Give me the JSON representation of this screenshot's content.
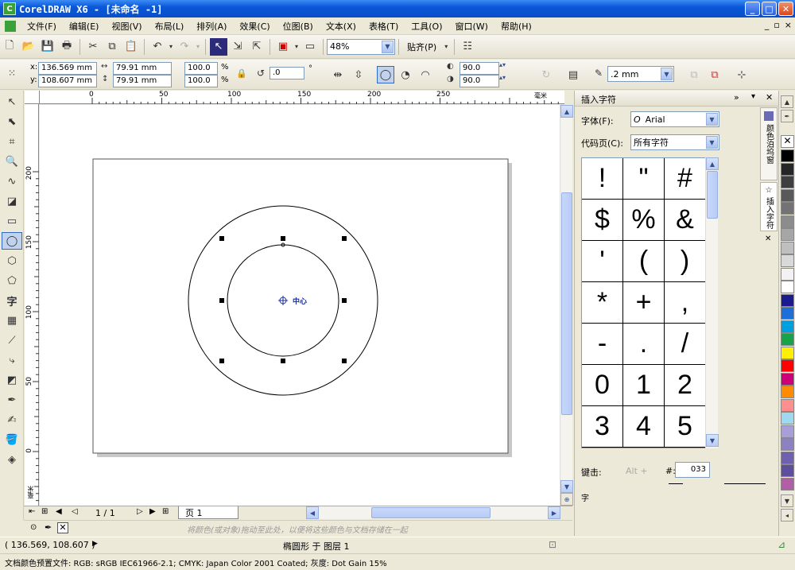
{
  "window": {
    "title": "CorelDRAW X6 - [未命名 -1]",
    "controls": {
      "minimize": "_",
      "maximize": "□",
      "close": "✕"
    }
  },
  "menu": {
    "items": [
      "文件(F)",
      "编辑(E)",
      "视图(V)",
      "布局(L)",
      "排列(A)",
      "效果(C)",
      "位图(B)",
      "文本(X)",
      "表格(T)",
      "工具(O)",
      "窗口(W)",
      "帮助(H)"
    ],
    "mdi_controls": [
      "_",
      "▫",
      "×"
    ]
  },
  "toolbar": {
    "zoom": "48%",
    "snap_label": "贴齐(P)",
    "icons": [
      "new-icon",
      "open-icon",
      "save-icon",
      "print-icon",
      "cut-icon",
      "copy-icon",
      "paste-icon",
      "undo-icon",
      "redo-icon",
      "search-content-icon",
      "import-icon",
      "export-icon",
      "publish-pdf-icon",
      "app-launcher-icon",
      "welcome-screen-icon",
      "options-icon"
    ]
  },
  "property_bar": {
    "x": "136.569 mm",
    "y": "108.607 mm",
    "width": "79.91 mm",
    "height": "79.91 mm",
    "scale_x": "100.0",
    "scale_y": "100.0",
    "percent_symbol": "%",
    "rotation": ".0",
    "degree_symbol": "°",
    "start_angle": "90.0",
    "end_angle": "90.0",
    "outline_width": ".2 mm",
    "label_x": "x:",
    "label_y": "y:"
  },
  "rulers": {
    "h_ticks": [
      "0",
      "50",
      "100",
      "150",
      "200",
      "250"
    ],
    "h_unit": "毫米",
    "v_ticks": [
      "200",
      "150",
      "100",
      "50",
      "0"
    ],
    "v_unit": "毫米"
  },
  "canvas": {
    "center_label": "中心"
  },
  "page_nav": {
    "page_count": "1 / 1",
    "page_tab": "页 1"
  },
  "color_hint": "将颜色(或对象)拖动至此处，以便将这些颜色与文档存储在一起",
  "docker": {
    "title": "插入字符",
    "font_label": "字体(F):",
    "font_value": "Arial",
    "codepage_label": "代码页(C):",
    "codepage_value": "所有字符",
    "glyphs": [
      "!",
      "\"",
      "#",
      "$",
      "%",
      "&",
      "'",
      "(",
      ")",
      "*",
      "+",
      ",",
      "-",
      ".",
      "/",
      "0",
      "1",
      "2",
      "3",
      "4",
      "5"
    ],
    "keystroke_label": "键击:",
    "keystroke_value": "Alt +",
    "hash_label": "#:",
    "code_value": "033",
    "char_label": "字"
  },
  "side_tabs": [
    "颜色泊坞窗",
    "插入字符"
  ],
  "palette": [
    "#ffffff",
    "#000000",
    "#262626",
    "#3f3f3f",
    "#595959",
    "#737373",
    "#8c8c8c",
    "#a6a6a6",
    "#bfbfbf",
    "#d9d9d9",
    "#f2f2f2",
    "#ffffff",
    "#1b1b8f",
    "#1c6fd8",
    "#00a0e0",
    "#16a34a",
    "#ffef00",
    "#ff0000",
    "#cc0077",
    "#ff8c00",
    "#ff8f8f",
    "#a0d8ef",
    "#a89fd8",
    "#8c82c2",
    "#7060b0",
    "#5f4e9e",
    "#b05fa5"
  ],
  "status": {
    "coords": "( 136.569, 108.607 )",
    "object_info": "椭圆形 于 图层 1",
    "color_profile": "文档颜色预置文件: RGB: sRGB IEC61966-2.1; CMYK: Japan Color 2001 Coated; 灰度: Dot Gain 15%"
  }
}
